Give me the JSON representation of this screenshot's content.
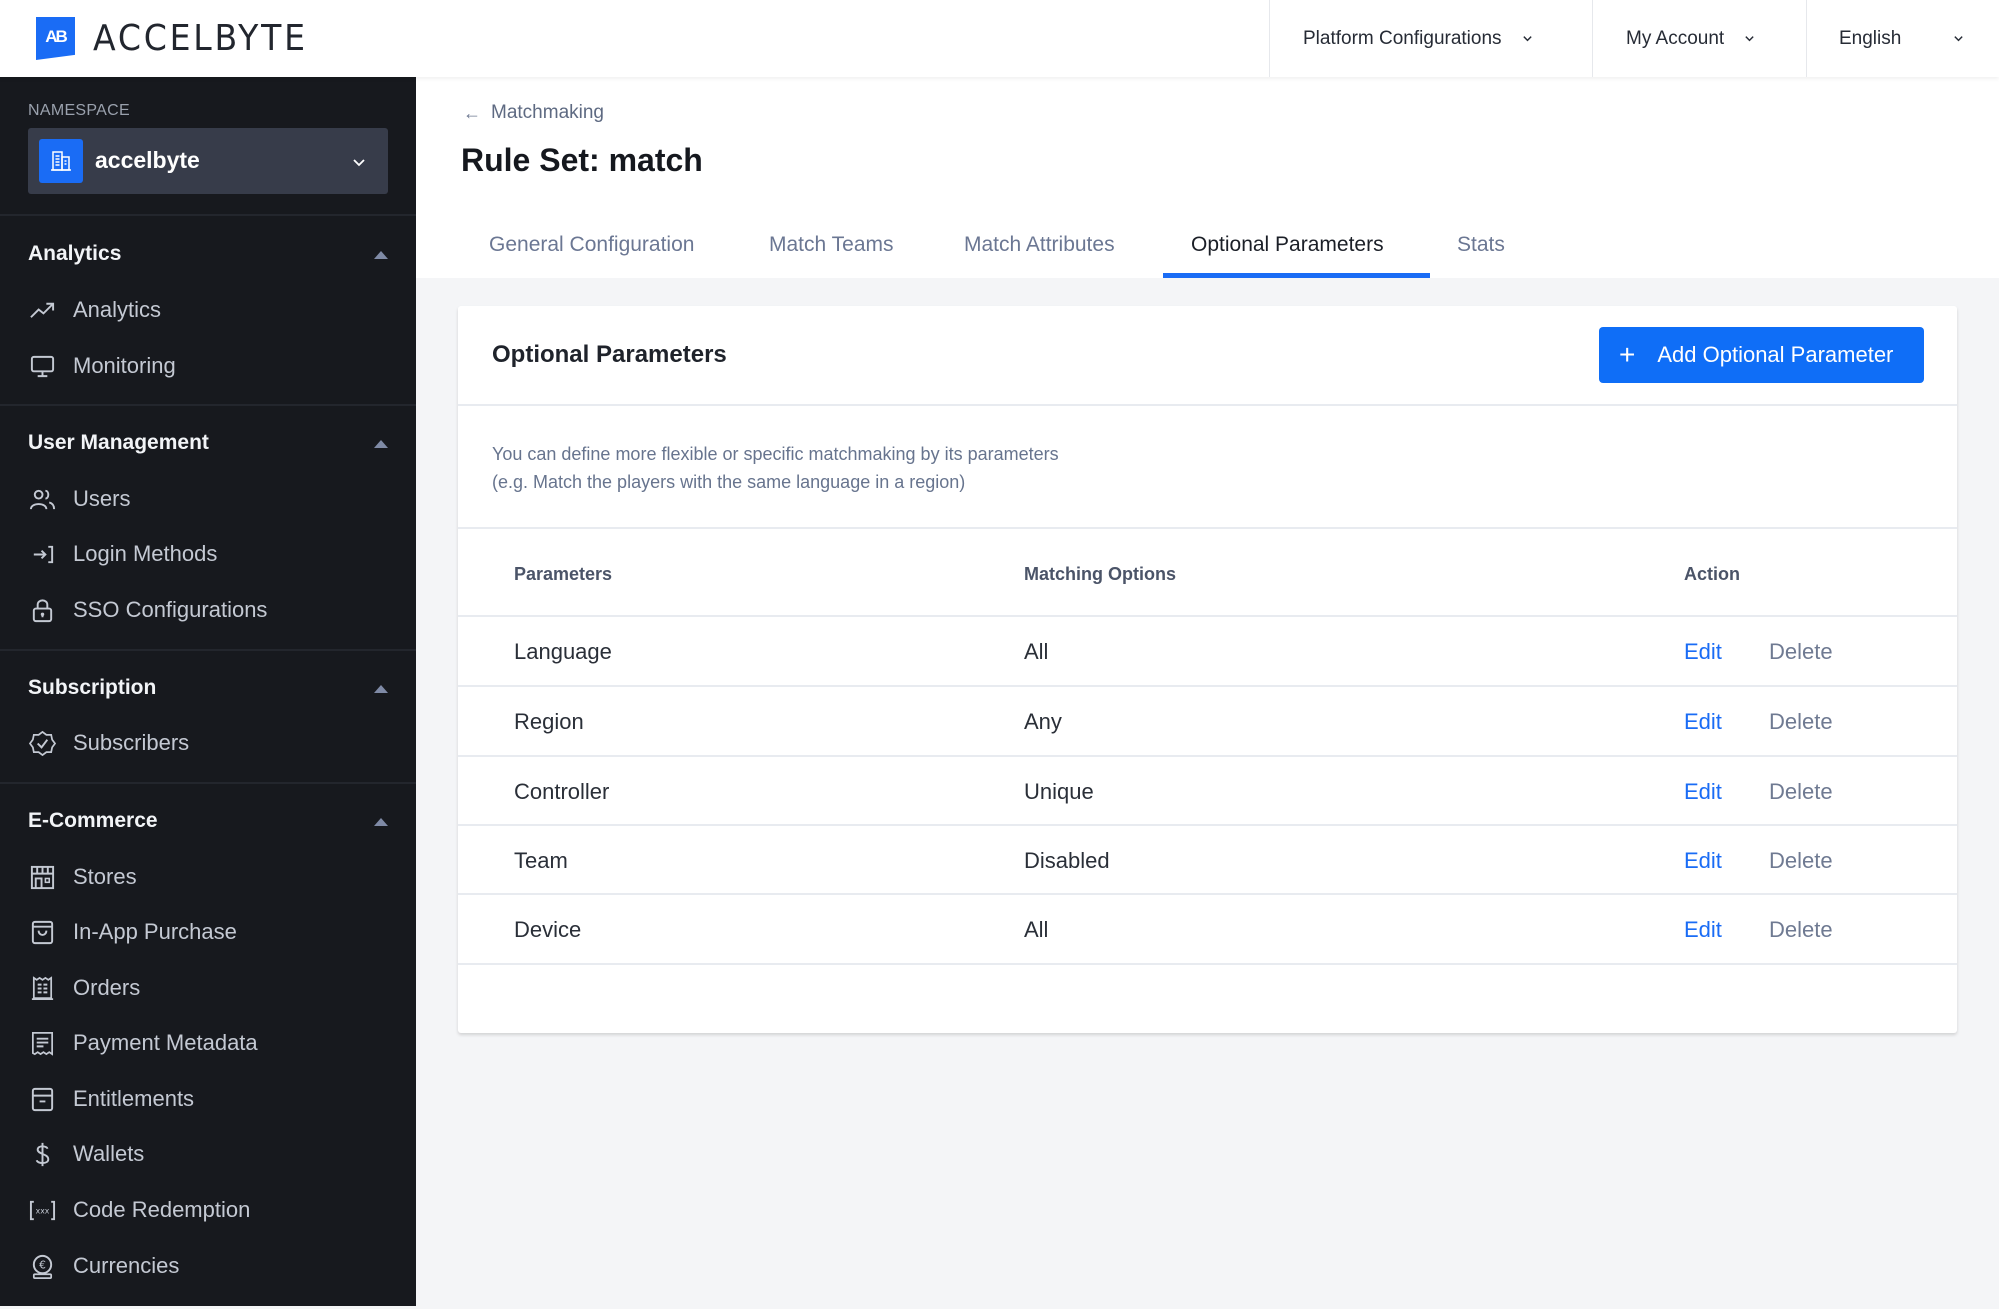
{
  "header": {
    "brand": "ACCELBYTE",
    "brand_mark": "AB",
    "menus": [
      {
        "label": "Platform Configurations"
      },
      {
        "label": "My Account"
      },
      {
        "label": "English"
      }
    ]
  },
  "sidebar": {
    "namespace_label": "NAMESPACE",
    "namespace_value": "accelbyte",
    "sections": [
      {
        "title": "Analytics",
        "items": [
          {
            "label": "Analytics",
            "icon": "trending-up-icon"
          },
          {
            "label": "Monitoring",
            "icon": "monitor-icon"
          }
        ]
      },
      {
        "title": "User Management",
        "items": [
          {
            "label": "Users",
            "icon": "users-icon"
          },
          {
            "label": "Login Methods",
            "icon": "login-icon"
          },
          {
            "label": "SSO Configurations",
            "icon": "lock-icon"
          }
        ]
      },
      {
        "title": "Subscription",
        "items": [
          {
            "label": "Subscribers",
            "icon": "badge-check-icon"
          }
        ]
      },
      {
        "title": "E-Commerce",
        "items": [
          {
            "label": "Stores",
            "icon": "store-icon"
          },
          {
            "label": "In-App Purchase",
            "icon": "shopping-bag-icon"
          },
          {
            "label": "Orders",
            "icon": "receipt-icon"
          },
          {
            "label": "Payment Metadata",
            "icon": "document-icon"
          },
          {
            "label": "Entitlements",
            "icon": "archive-icon"
          },
          {
            "label": "Wallets",
            "icon": "dollar-icon"
          },
          {
            "label": "Code Redemption",
            "icon": "code-bracket-icon"
          },
          {
            "label": "Currencies",
            "icon": "euro-coin-icon"
          }
        ]
      }
    ]
  },
  "page": {
    "breadcrumb": "Matchmaking",
    "title": "Rule Set: match",
    "tabs": [
      {
        "label": "General Configuration",
        "active": false
      },
      {
        "label": "Match Teams",
        "active": false
      },
      {
        "label": "Match Attributes",
        "active": false
      },
      {
        "label": "Optional Parameters",
        "active": true
      },
      {
        "label": "Stats",
        "active": false
      }
    ]
  },
  "card": {
    "title": "Optional Parameters",
    "add_button": "Add Optional Parameter",
    "description_line1": "You can define more flexible or specific matchmaking by its parameters",
    "description_line2": "(e.g. Match the players with the same language in a region)",
    "columns": [
      "Parameters",
      "Matching Options",
      "Action"
    ],
    "rows": [
      {
        "parameter": "Language",
        "option": "All",
        "edit": "Edit",
        "delete": "Delete"
      },
      {
        "parameter": "Region",
        "option": "Any",
        "edit": "Edit",
        "delete": "Delete"
      },
      {
        "parameter": "Controller",
        "option": "Unique",
        "edit": "Edit",
        "delete": "Delete"
      },
      {
        "parameter": "Team",
        "option": "Disabled",
        "edit": "Edit",
        "delete": "Delete"
      },
      {
        "parameter": "Device",
        "option": "All",
        "edit": "Edit",
        "delete": "Delete"
      }
    ]
  },
  "colors": {
    "accent": "#1a6cf5",
    "sidebar_bg": "#17191e",
    "page_bg": "#f4f5f7"
  }
}
